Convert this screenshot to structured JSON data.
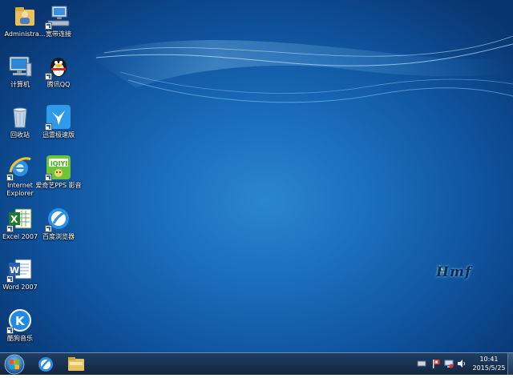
{
  "desktop": {
    "icons": [
      {
        "label": "Administra...",
        "icon": "folder-user-icon"
      },
      {
        "label": "宽带连接",
        "icon": "network-connection-icon"
      },
      {
        "label": "计算机",
        "icon": "computer-icon"
      },
      {
        "label": "腾讯QQ",
        "icon": "qq-penguin-icon"
      },
      {
        "label": "回收站",
        "icon": "recycle-bin-icon"
      },
      {
        "label": "迅雷极速版",
        "icon": "thunder-bird-icon"
      },
      {
        "label": "Internet Explorer",
        "icon": "internet-explorer-icon"
      },
      {
        "label": "爱奇艺PPS 影音",
        "icon": "iqiyi-icon"
      },
      {
        "label": "Excel 2007",
        "icon": "excel-icon"
      },
      {
        "label": "百度浏览器",
        "icon": "baidu-browser-icon"
      },
      {
        "label": "Word 2007",
        "icon": "word-icon"
      },
      {
        "label": "酷狗音乐",
        "icon": "kugou-music-icon"
      }
    ],
    "watermark_logo": "Hmf",
    "background_color": "#1a6cba"
  },
  "taskbar": {
    "start_icon": "windows-orb-icon",
    "pinned": [
      {
        "name": "baidu-browser-taskbar",
        "icon": "baidu-browser-icon"
      },
      {
        "name": "explorer-taskbar",
        "icon": "folder-icon"
      }
    ],
    "tray_icons": [
      "keyboard-icon",
      "flag-icon",
      "network-icon",
      "volume-icon"
    ],
    "clock_time": "10:41",
    "clock_date": "2015/5/25"
  }
}
